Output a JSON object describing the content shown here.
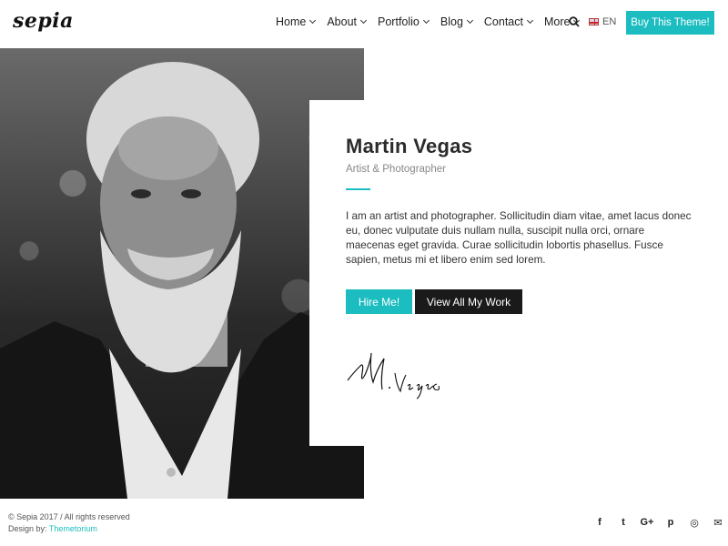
{
  "header": {
    "logo": "sepia",
    "nav": [
      {
        "label": "Home"
      },
      {
        "label": "About"
      },
      {
        "label": "Portfolio"
      },
      {
        "label": "Blog"
      },
      {
        "label": "Contact"
      },
      {
        "label": "More"
      }
    ],
    "language": "EN",
    "buy_label": "Buy This Theme!"
  },
  "hero": {
    "name": "Martin Vegas",
    "role": "Artist & Photographer",
    "bio": "I am an artist and photographer. Sollicitudin diam vitae, amet lacus donec eu, donec vulputate duis nullam nulla, suscipit nulla orci, ornare maecenas eget gravida. Curae sollicitudin lobortis phasellus. Fusce sapien, metus mi et libero enim sed lorem.",
    "hire_label": "Hire Me!",
    "view_label": "View All My Work",
    "signature": "M. Vegas"
  },
  "footer": {
    "copyright": "© Sepia 2017 / All rights reserved",
    "design_by": "Design by:",
    "designer": "Themetorium",
    "social": [
      {
        "icon": "facebook-icon",
        "glyph": "f"
      },
      {
        "icon": "twitter-icon",
        "glyph": "t"
      },
      {
        "icon": "google-plus-icon",
        "glyph": "G+"
      },
      {
        "icon": "pinterest-icon",
        "glyph": "p"
      },
      {
        "icon": "dribbble-icon",
        "glyph": "◎"
      },
      {
        "icon": "email-icon",
        "glyph": "✉"
      }
    ]
  },
  "colors": {
    "accent": "#1cbdc1",
    "dark": "#1a1a1a"
  }
}
